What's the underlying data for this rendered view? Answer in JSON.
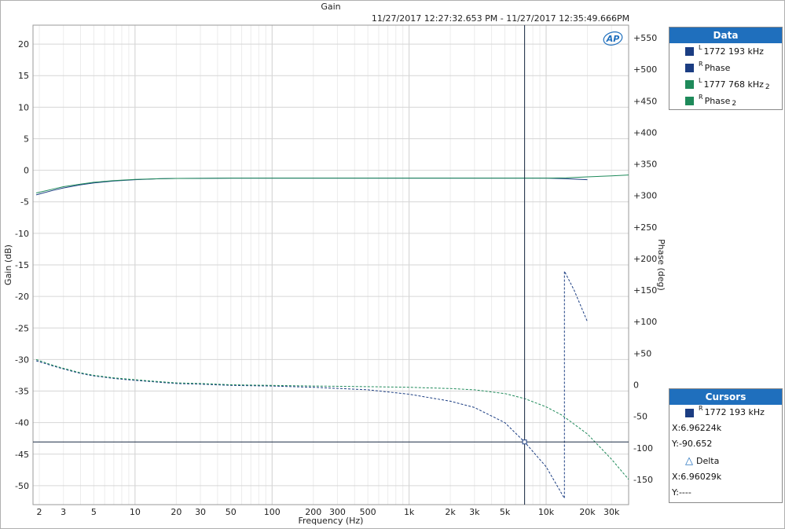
{
  "window": {
    "title": "Gain",
    "timestamp": "11/27/2017 12:27:32.653 PM - 11/27/2017 12:35:49.666PM",
    "logo": "AP"
  },
  "chart_data": {
    "type": "line",
    "title": "Gain",
    "xlabel": "Frequency (Hz)",
    "ylabel": "Gain (dB)",
    "y2label": "Phase (deg)",
    "x_scale": "log",
    "xlim": [
      1.8,
      40000
    ],
    "ylim": [
      -53,
      23
    ],
    "y2lim": [
      -190,
      570
    ],
    "grid": true,
    "x_ticks": [
      {
        "v": 2,
        "label": "2"
      },
      {
        "v": 3,
        "label": "3"
      },
      {
        "v": 5,
        "label": "5"
      },
      {
        "v": 10,
        "label": "10"
      },
      {
        "v": 20,
        "label": "20"
      },
      {
        "v": 30,
        "label": "30"
      },
      {
        "v": 50,
        "label": "50"
      },
      {
        "v": 100,
        "label": "100"
      },
      {
        "v": 200,
        "label": "200"
      },
      {
        "v": 300,
        "label": "300"
      },
      {
        "v": 500,
        "label": "500"
      },
      {
        "v": 1000,
        "label": "1k"
      },
      {
        "v": 2000,
        "label": "2k"
      },
      {
        "v": 3000,
        "label": "3k"
      },
      {
        "v": 5000,
        "label": "5k"
      },
      {
        "v": 10000,
        "label": "10k"
      },
      {
        "v": 20000,
        "label": "20k"
      },
      {
        "v": 30000,
        "label": "30k"
      }
    ],
    "y_ticks": [
      {
        "v": 20,
        "label": "20"
      },
      {
        "v": 15,
        "label": "15"
      },
      {
        "v": 10,
        "label": "10"
      },
      {
        "v": 5,
        "label": "5"
      },
      {
        "v": 0,
        "label": "0"
      },
      {
        "v": -5,
        "label": "-5"
      },
      {
        "v": -10,
        "label": "-10"
      },
      {
        "v": -15,
        "label": "-15"
      },
      {
        "v": -20,
        "label": "-20"
      },
      {
        "v": -25,
        "label": "-25"
      },
      {
        "v": -30,
        "label": "-30"
      },
      {
        "v": -35,
        "label": "-35"
      },
      {
        "v": -40,
        "label": "-40"
      },
      {
        "v": -45,
        "label": "-45"
      },
      {
        "v": -50,
        "label": "-50"
      }
    ],
    "y2_ticks": [
      {
        "v": 550,
        "label": "+550"
      },
      {
        "v": 500,
        "label": "+500"
      },
      {
        "v": 450,
        "label": "+450"
      },
      {
        "v": 400,
        "label": "+400"
      },
      {
        "v": 350,
        "label": "+350"
      },
      {
        "v": 300,
        "label": "+300"
      },
      {
        "v": 250,
        "label": "+250"
      },
      {
        "v": 200,
        "label": "+200"
      },
      {
        "v": 150,
        "label": "+150"
      },
      {
        "v": 100,
        "label": "+100"
      },
      {
        "v": 50,
        "label": "+50"
      },
      {
        "v": 0,
        "label": "0"
      },
      {
        "v": -50,
        "label": "-50"
      },
      {
        "v": -100,
        "label": "-100"
      },
      {
        "v": -150,
        "label": "-150"
      }
    ],
    "series": [
      {
        "name": "1772 193 kHz",
        "channel": "L",
        "axis": "left",
        "color": "#1b3d82",
        "dash": false,
        "x": [
          1.9,
          2.5,
          3,
          4,
          5,
          7,
          10,
          15,
          20,
          50,
          100,
          1000,
          5000,
          10000,
          14000,
          20000
        ],
        "y": [
          -3.9,
          -3.2,
          -2.8,
          -2.3,
          -2.0,
          -1.7,
          -1.5,
          -1.35,
          -1.3,
          -1.25,
          -1.25,
          -1.25,
          -1.25,
          -1.25,
          -1.35,
          -1.5
        ]
      },
      {
        "name": "Phase",
        "channel": "R",
        "axis": "right",
        "color": "#1b3d82",
        "dash": true,
        "x": [
          1.9,
          2.5,
          3,
          4,
          5,
          7,
          10,
          15,
          20,
          30,
          50,
          100,
          200,
          500,
          1000,
          2000,
          3000,
          5000,
          6962,
          10000,
          13600,
          13601,
          16000,
          20000
        ],
        "y": [
          38,
          30,
          25,
          18,
          14,
          10,
          7,
          4,
          2,
          1,
          -1,
          -2,
          -4,
          -8,
          -15,
          -26,
          -36,
          -60,
          -90.652,
          -130,
          -180,
          180,
          150,
          100
        ]
      },
      {
        "name": "1777 768 kHz",
        "channel": "L",
        "suffix": "2",
        "axis": "left",
        "color": "#1e8a5a",
        "dash": false,
        "x": [
          1.9,
          2.5,
          3,
          4,
          5,
          7,
          10,
          15,
          20,
          50,
          100,
          1000,
          5000,
          10000,
          14000,
          20000,
          30000,
          40000
        ],
        "y": [
          -3.6,
          -3.0,
          -2.6,
          -2.2,
          -1.9,
          -1.65,
          -1.45,
          -1.35,
          -1.3,
          -1.25,
          -1.25,
          -1.25,
          -1.25,
          -1.25,
          -1.2,
          -1.05,
          -0.9,
          -0.75
        ]
      },
      {
        "name": "Phase",
        "channel": "R",
        "suffix": "2",
        "axis": "right",
        "color": "#1e8a5a",
        "dash": true,
        "x": [
          1.9,
          2.5,
          3,
          4,
          5,
          7,
          10,
          15,
          20,
          30,
          50,
          100,
          200,
          500,
          1000,
          2000,
          3000,
          5000,
          7000,
          10000,
          13000,
          20000,
          30000,
          40000
        ],
        "y": [
          40,
          31,
          26,
          19,
          15,
          11,
          8,
          5,
          3,
          2,
          0,
          -1,
          -2,
          -3,
          -4,
          -6,
          -8,
          -14,
          -22,
          -35,
          -48,
          -78,
          -118,
          -150
        ]
      }
    ],
    "cursor": {
      "x": 6962.24,
      "y2": -90.652
    }
  },
  "legend": {
    "title": "Data",
    "items": [
      {
        "sup": "L",
        "label": "1772 193 kHz",
        "sub": "",
        "color": "#1b3d82"
      },
      {
        "sup": "R",
        "label": "Phase",
        "sub": "",
        "color": "#1b3d82"
      },
      {
        "sup": "L",
        "label": "1777 768 kHz",
        "sub": "2",
        "color": "#1e8a5a"
      },
      {
        "sup": "R",
        "label": "Phase",
        "sub": "2",
        "color": "#1e8a5a"
      }
    ]
  },
  "cursors": {
    "title": "Cursors",
    "item_sup": "R",
    "item_label": "1772 193 kHz",
    "item_color": "#1b3d82",
    "x": "X:6.96224k",
    "y": "Y:-90.652",
    "delta_label": "Delta",
    "delta_x": "X:6.96029k",
    "delta_y": "Y:----"
  }
}
